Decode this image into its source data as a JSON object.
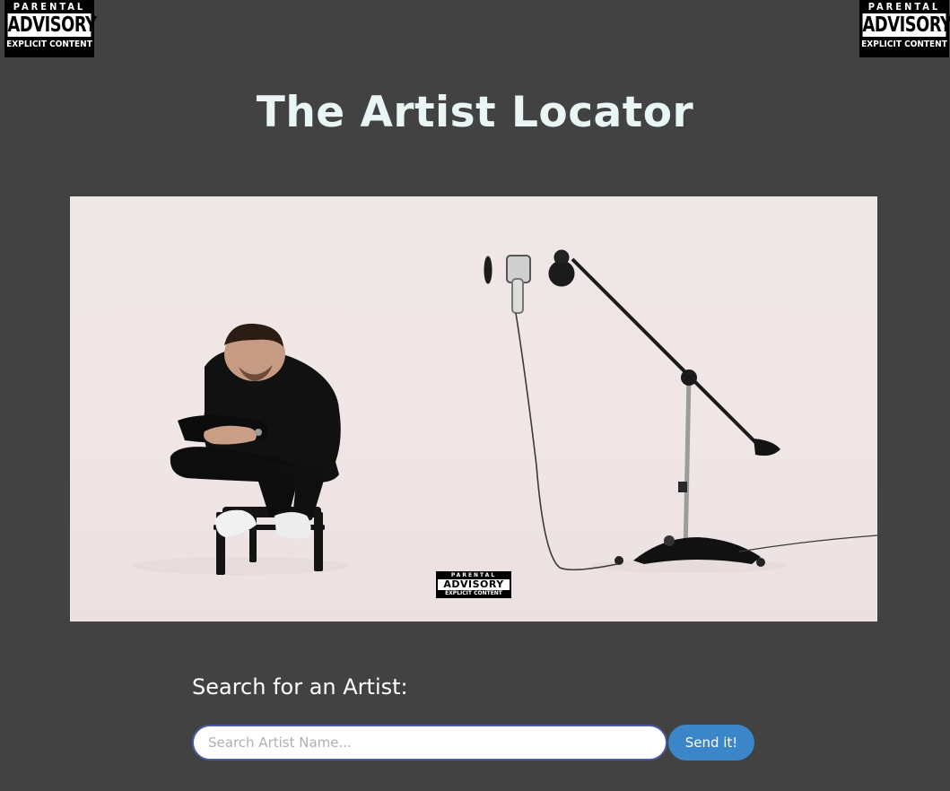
{
  "header": {
    "title": "The Artist Locator"
  },
  "advisory_badge": {
    "line1": "PARENTAL",
    "line2": "ADVISORY",
    "line3": "EXPLICIT CONTENT"
  },
  "hero": {
    "icon": "album-cover-photo"
  },
  "search": {
    "label": "Search for an Artist:",
    "placeholder": "Search Artist Name...",
    "value": "",
    "button_label": "Send it!"
  },
  "colors": {
    "background": "#424242",
    "title": "#eaf6f6",
    "button": "#3a86c8",
    "input_border": "#4a5aa8"
  }
}
